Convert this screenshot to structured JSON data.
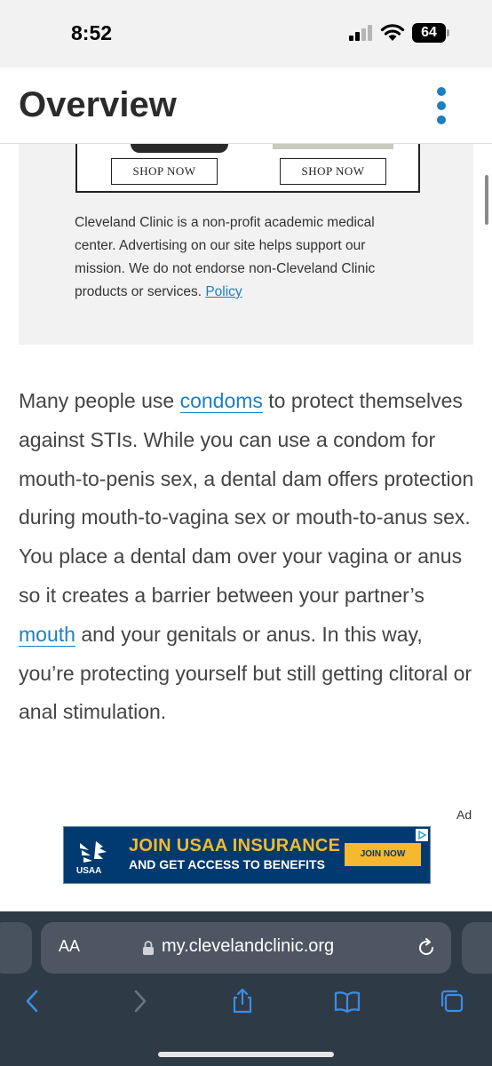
{
  "status_bar": {
    "time": "8:52",
    "battery": "64"
  },
  "header": {
    "title": "Overview"
  },
  "ad_panel": {
    "shop_button_1": "SHOP NOW",
    "shop_button_2": "SHOP NOW",
    "disclaimer": "Cleveland Clinic is a non-profit academic medical center. Advertising on our site helps support our mission. We do not endorse non-Cleveland Clinic products or services.",
    "policy_link": "Policy"
  },
  "article": {
    "p1_before": "Many people use ",
    "link_condoms": "condoms",
    "p1_middle": " to protect themselves against STIs. While you can use a condom for mouth-to-penis sex, a dental dam offers protection during mouth-to-vagina sex or mouth-to-anus sex. You place a dental dam over your vagina or anus so it creates a barrier between your partner’s ",
    "link_mouth": "mouth",
    "p1_after": " and your genitals or anus. In this way, you’re protecting yourself but still getting clitoral or anal stimulation."
  },
  "banner_ad": {
    "label": "Ad",
    "brand": "USAA",
    "line1": "JOIN USAA INSURANCE",
    "line2": "AND GET ACCESS TO BENEFITS",
    "cta": "JOIN NOW"
  },
  "browser": {
    "text_size_label": "AA",
    "url": "my.clevelandclinic.org"
  },
  "colors": {
    "link": "#1c7fc2",
    "banner_bg": "#003a70",
    "banner_accent": "#f5b82e",
    "browser_bg": "#2f3a47"
  }
}
